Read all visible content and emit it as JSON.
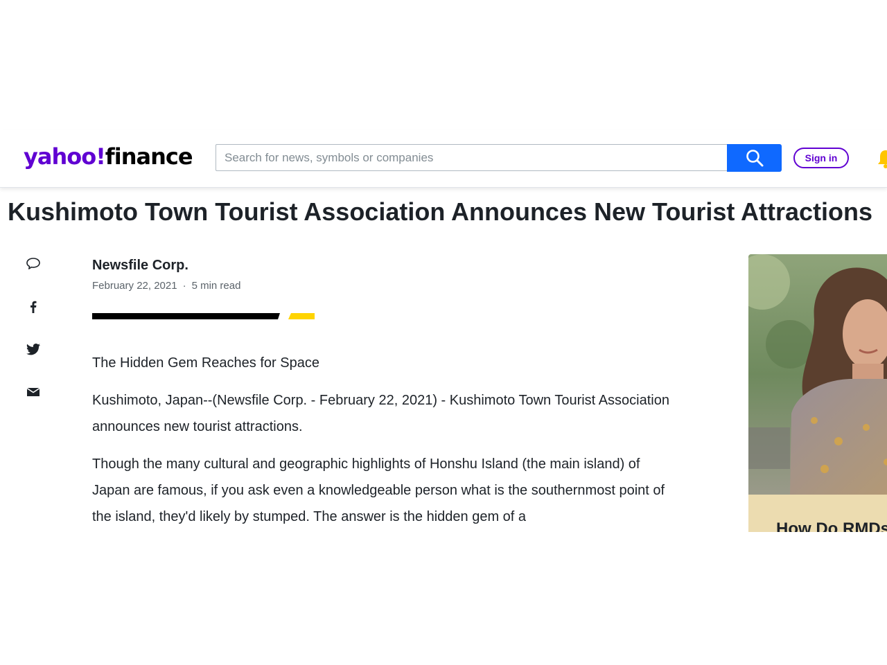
{
  "header": {
    "logo_yahoo": "yahoo!",
    "logo_finance": "finance",
    "search_placeholder": "Search for news, symbols or companies",
    "signin_label": "Sign in",
    "icons": {
      "search": "search-icon",
      "notifications": "bell-icon"
    }
  },
  "article": {
    "headline": "Kushimoto Town Tourist Association Announces New Tourist Attractions",
    "author": "Newsfile Corp.",
    "date": "February 22, 2021",
    "separator": "·",
    "read_time": "5 min read",
    "paragraphs": [
      "The Hidden Gem Reaches for Space",
      "Kushimoto, Japan--(Newsfile Corp. - February 22, 2021) - Kushimoto Town Tourist Association announces new tourist attractions.",
      "Though the many cultural and geographic highlights of Honshu Island (the main island) of Japan are famous, if you ask even a knowledgeable person what is the southernmost point of the island, they'd likely by stumped. The answer is the hidden gem of a"
    ]
  },
  "share_rail": {
    "items": [
      "comment-icon",
      "facebook-icon",
      "twitter-icon",
      "mail-icon"
    ]
  },
  "ad": {
    "title": "How Do RMDs"
  },
  "colors": {
    "brand_purple": "#6001d2",
    "search_blue": "#0f69ff",
    "accent_yellow": "#ffd400",
    "text_dark": "#1d2228"
  }
}
